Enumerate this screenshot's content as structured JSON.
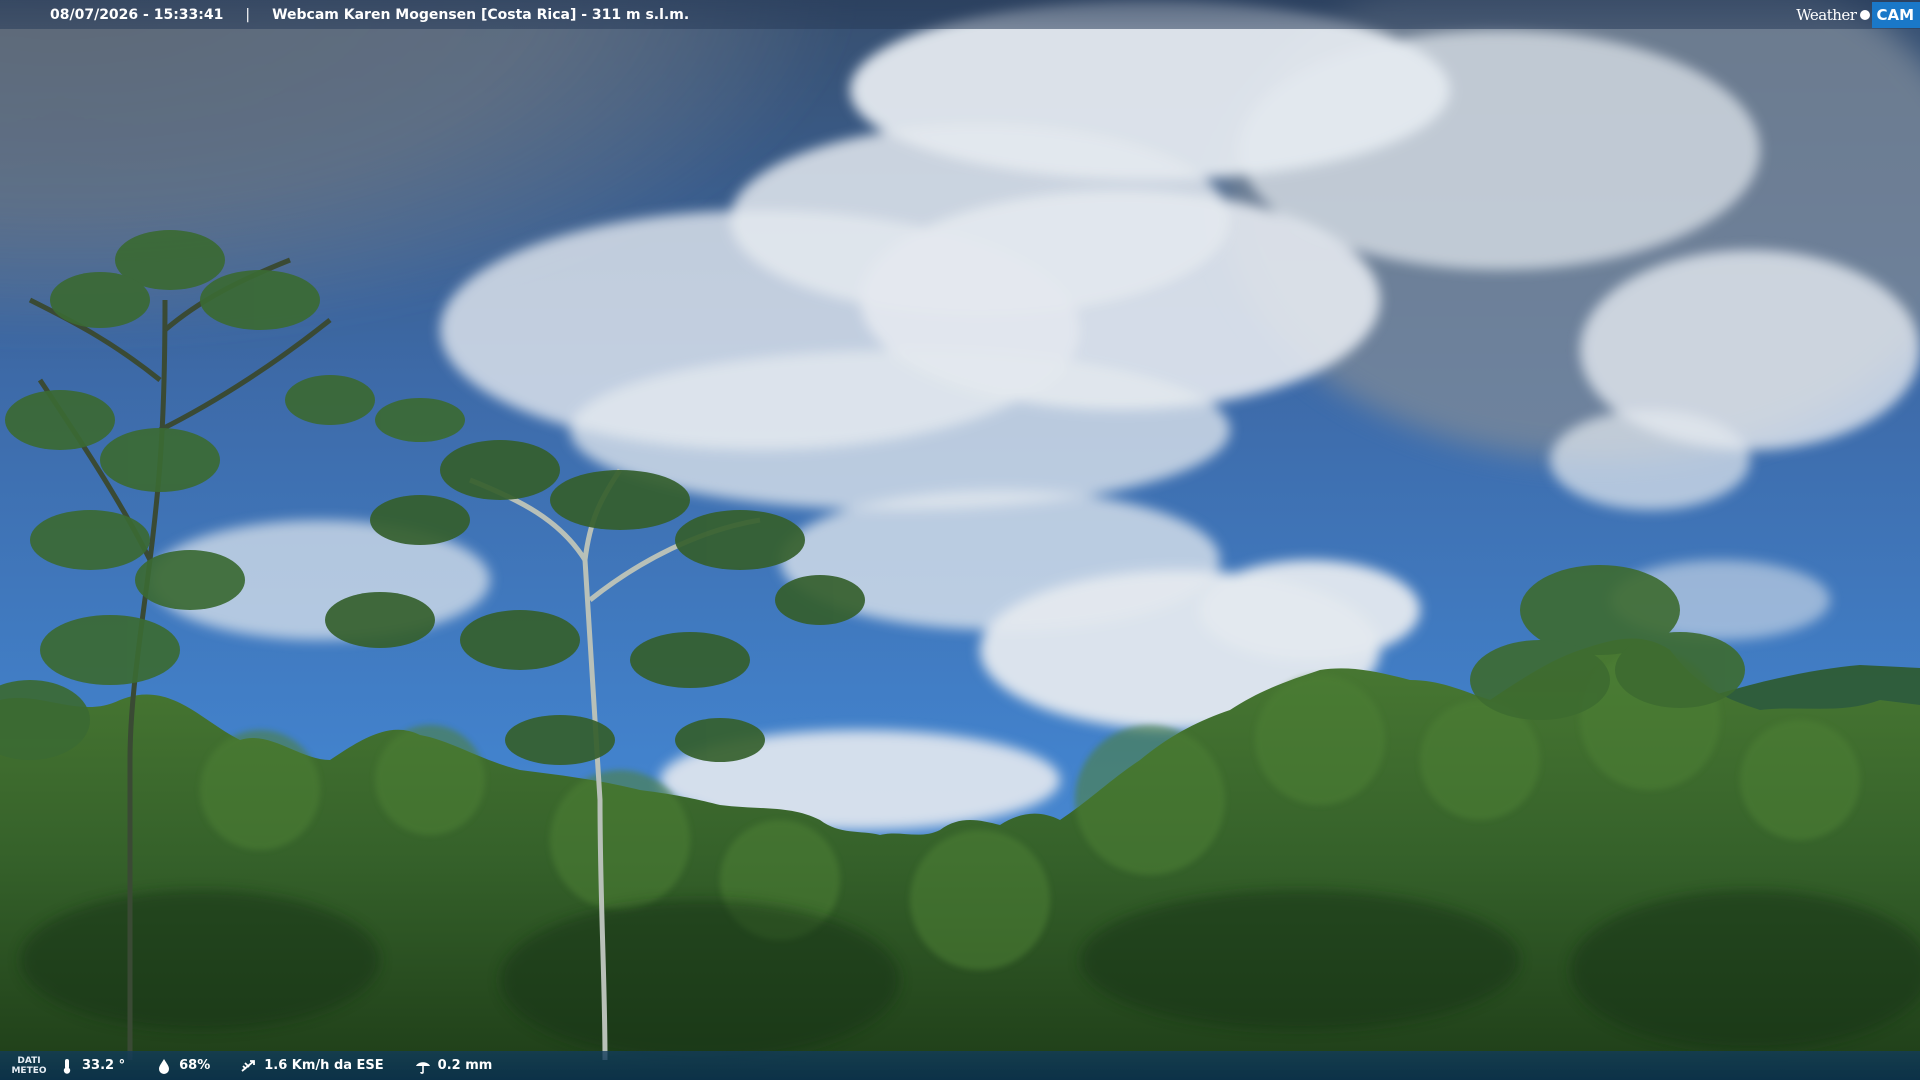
{
  "header": {
    "datetime": "08/07/2026 - 15:33:41",
    "separator": "|",
    "title": "Webcam Karen Mogensen [Costa Rica] - 311 m s.l.m."
  },
  "logo": {
    "word1": "Weather",
    "word2": "CAM"
  },
  "footer": {
    "section_label_line1": "DATI",
    "section_label_line2": "METEO",
    "temperature": "33.2 °",
    "humidity": "68%",
    "wind": "1.6 Km/h da ESE",
    "rain": "0.2 mm",
    "icons": [
      "thermometer-icon",
      "humidity-drop-icon",
      "wind-icon",
      "rain-gauge-icon"
    ]
  },
  "colors": {
    "sky_top": "#2f4f7a",
    "sky_mid": "#3b72b8",
    "forest_dark": "#1f3d1a",
    "forest_mid": "#3e6b2c",
    "bar": "#1c4a72",
    "logo_accent": "#1a78c8"
  }
}
